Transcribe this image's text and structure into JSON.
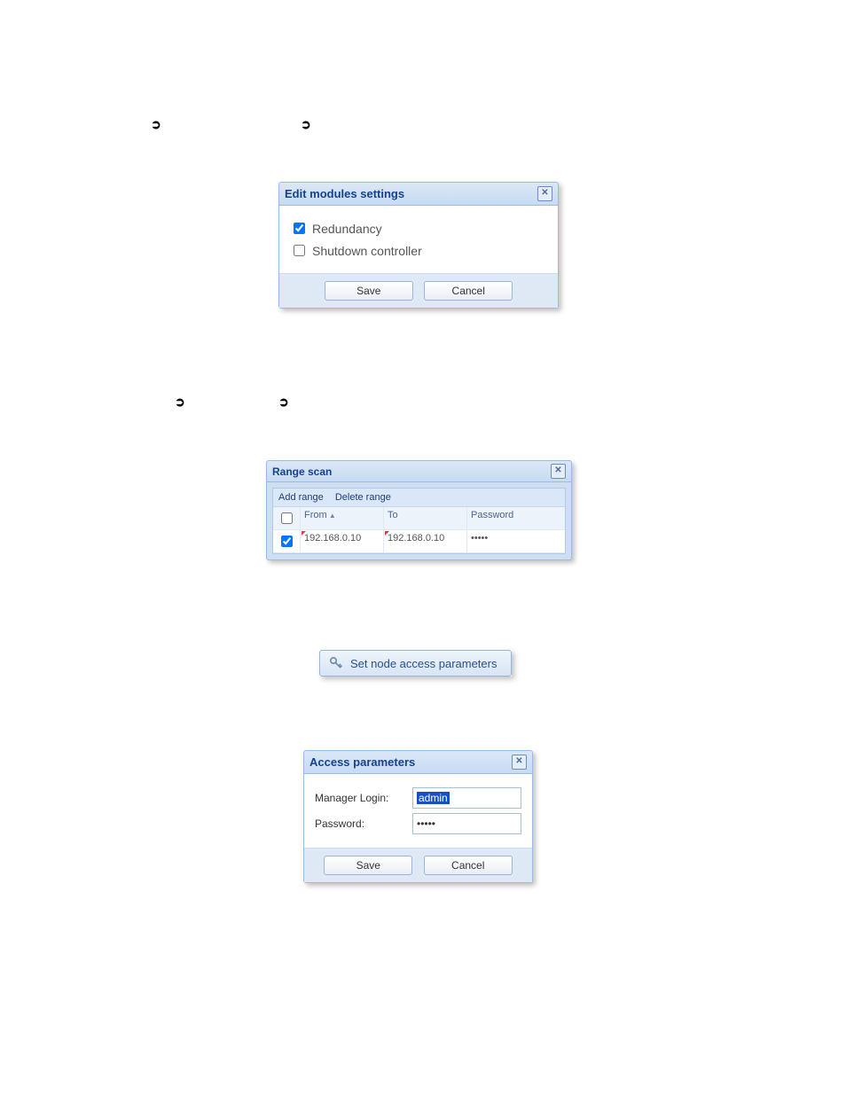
{
  "arrows": {
    "glyph": "➲"
  },
  "editModules": {
    "title": "Edit modules settings",
    "opt1": "Redundancy",
    "opt2": "Shutdown controller",
    "save": "Save",
    "cancel": "Cancel",
    "opt1_checked": true,
    "opt2_checked": false
  },
  "rangeScan": {
    "title": "Range scan",
    "addRange": "Add range",
    "deleteRange": "Delete range",
    "colFrom": "From",
    "colTo": "To",
    "colPwd": "Password",
    "row": {
      "from": "192.168.0.10",
      "to": "192.168.0.10",
      "pwd": "•••••",
      "checked": true
    }
  },
  "nodeButton": {
    "label": "Set node access parameters"
  },
  "accessParams": {
    "title": "Access parameters",
    "loginLabel": "Manager Login:",
    "loginValue": "admin",
    "pwdLabel": "Password:",
    "pwdValue": "•••••",
    "save": "Save",
    "cancel": "Cancel"
  }
}
